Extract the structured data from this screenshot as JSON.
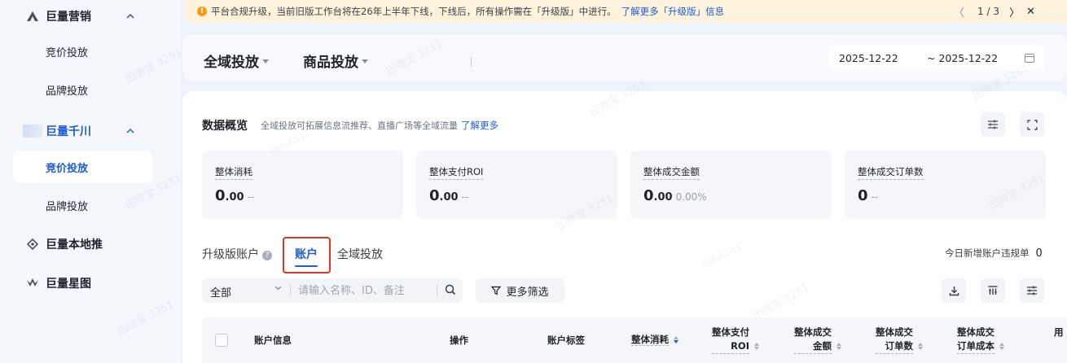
{
  "sidebar": {
    "groups": [
      {
        "label": "巨量营销",
        "icon": "triangle-logo-icon",
        "items": [
          "竞价投放",
          "品牌投放"
        ]
      },
      {
        "label": "巨量千川",
        "icon": "qianchuan-logo-icon",
        "items": [
          "竞价投放",
          "品牌投放"
        ],
        "active_item": "竞价投放"
      },
      {
        "label": "巨量本地推",
        "icon": "bendi-logo-icon"
      },
      {
        "label": "巨量星图",
        "icon": "xingtu-logo-icon"
      }
    ]
  },
  "notice": {
    "message": "平台合规升级，当前旧版工作台将在26年上半年下线，下线后，所有操作需在「升级版」中进行。",
    "link": "了解更多「升级版」信息",
    "pager": {
      "current": "1",
      "sep": "/",
      "total": "3"
    }
  },
  "header": {
    "title_left": "全域投放",
    "title_right": "商品投放",
    "date_start": "2025-12-22",
    "date_end": "~ 2025-12-22"
  },
  "overview": {
    "title": "数据概览",
    "subtitle": "全域投放可拓展信息流推荐、直播广场等全域流量",
    "link": "了解更多",
    "metrics": [
      {
        "label": "整体消耗",
        "int": "0",
        "dec": ".00",
        "compare": "--"
      },
      {
        "label": "整体支付ROI",
        "int": "0",
        "dec": ".00",
        "compare": "--"
      },
      {
        "label": "整体成交金额",
        "int": "0",
        "dec": ".00",
        "compare": "0.00%"
      },
      {
        "label": "整体成交订单数",
        "int": "0",
        "dec": "",
        "compare": "--"
      }
    ]
  },
  "tabs": {
    "items": [
      "升级版账户",
      "账户",
      "全域投放"
    ],
    "active": "账户",
    "help_icon": "?"
  },
  "today_rule": {
    "label": "今日新增账户违规单",
    "count": "0"
  },
  "filters": {
    "select_value": "全部",
    "search_placeholder": "请输入名称、ID、备注",
    "more_filter": "更多筛选"
  },
  "table": {
    "columns": [
      "账户信息",
      "操作",
      "账户标签",
      "整体消耗",
      "整体支付\nROI",
      "整体成交\n金额",
      "整体成交\n订单数",
      "整体成交\n订单成本",
      "用\n支"
    ]
  },
  "watermark": {
    "text": "田微宝 3251",
    "sub": "ItBPyCU11"
  },
  "colors": {
    "accent": "#1e5cd8",
    "warning": "#f29b1b",
    "highlight": "#d8382b"
  }
}
